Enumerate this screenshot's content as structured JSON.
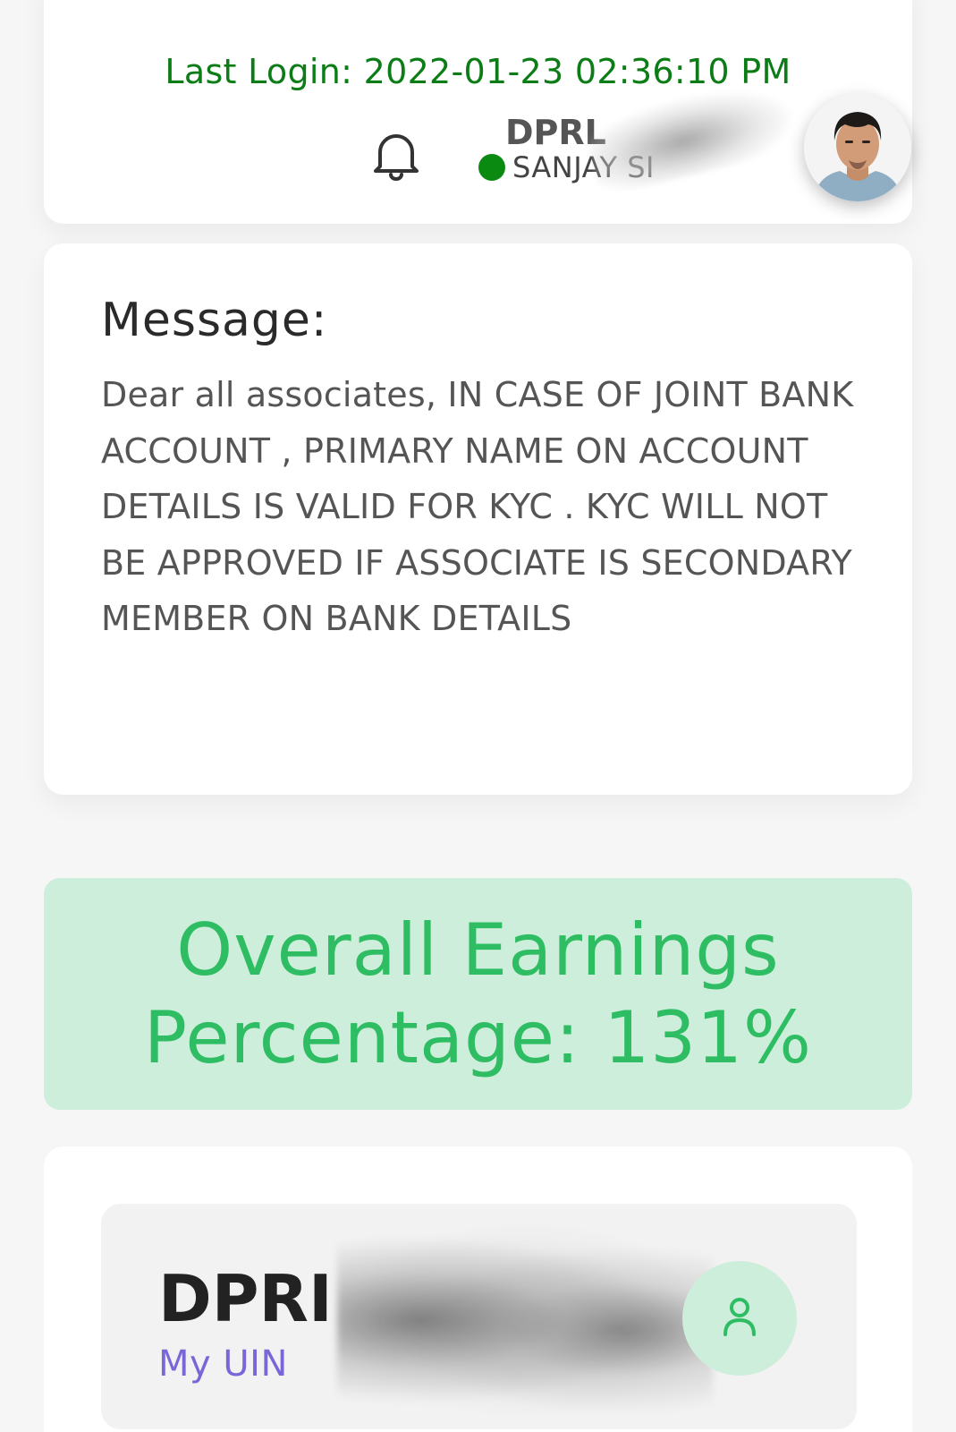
{
  "header": {
    "last_login": "Last Login: 2022-01-23 02:36:10 PM",
    "user_code": "DPRL",
    "user_name": "SANJAY SI",
    "status": "online",
    "status_color": "#0b8a12",
    "icons": {
      "notifications": "bell-icon"
    }
  },
  "message": {
    "title": "Message:",
    "body": "Dear all associates, IN CASE OF JOINT BANK ACCOUNT , PRIMARY NAME ON ACCOUNT DETAILS IS VALID FOR KYC . KYC WILL NOT BE APPROVED IF ASSOCIATE IS SECONDARY MEMBER ON BANK DETAILS"
  },
  "earnings": {
    "text": "Overall Earnings Percentage: 131%",
    "accent_color": "#2fbd63",
    "background_color": "#cdeedb"
  },
  "uin": {
    "value": "DPRI",
    "label": "My UIN",
    "icon": "user-icon"
  }
}
